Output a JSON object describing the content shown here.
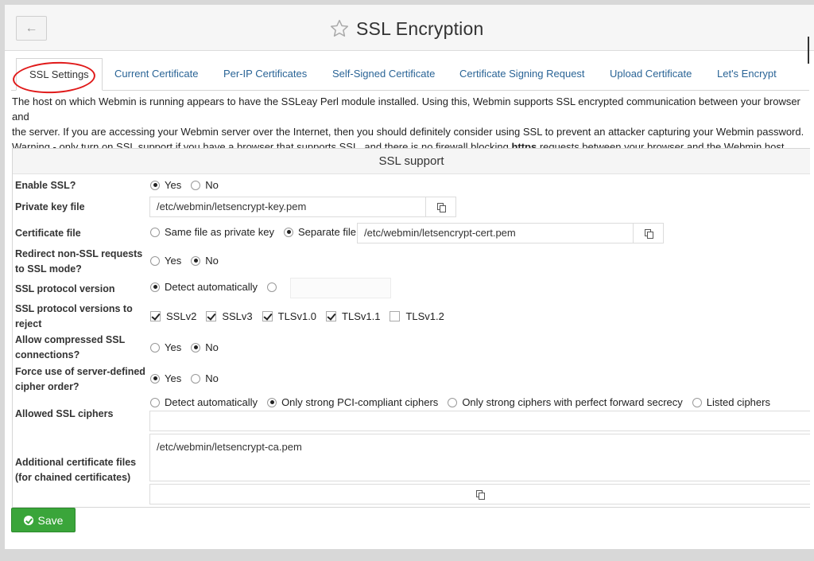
{
  "header": {
    "title": "SSL Encryption",
    "back_icon": "arrow-left-icon",
    "star_icon": "star-outline-icon"
  },
  "tabs": [
    {
      "label": "SSL Settings",
      "active": true
    },
    {
      "label": "Current Certificate"
    },
    {
      "label": "Per-IP Certificates"
    },
    {
      "label": "Self-Signed Certificate"
    },
    {
      "label": "Certificate Signing Request"
    },
    {
      "label": "Upload Certificate"
    },
    {
      "label": "Let's Encrypt"
    }
  ],
  "intro": {
    "line1": "The host on which Webmin is running appears to have the SSLeay Perl module installed. Using this, Webmin supports SSL encrypted communication between your browser and",
    "line2": "the server. If you are accessing your Webmin server over the Internet, then you should definitely consider using SSL to prevent an attacker capturing your Webmin password.",
    "line3_a": "Warning - only turn on SSL support if you have a browser that supports SSL, and there is no firewall blocking ",
    "line3_b": "https",
    "line3_c": " requests between your browser and the Webmin host."
  },
  "section": {
    "title": "SSL support",
    "enable_ssl": {
      "label": "Enable SSL?",
      "yes": "Yes",
      "no": "No",
      "value": "Yes"
    },
    "private_key": {
      "label": "Private key file",
      "value": "/etc/webmin/letsencrypt-key.pem"
    },
    "cert_file": {
      "label": "Certificate file",
      "opt_same": "Same file as private key",
      "opt_separate": "Separate file",
      "value": "/etc/webmin/letsencrypt-cert.pem",
      "selected": "Separate file"
    },
    "redirect": {
      "label_1": "Redirect non-SSL requests",
      "label_2": "to SSL mode?",
      "yes": "Yes",
      "no": "No",
      "value": "No"
    },
    "protocol_version": {
      "label": "SSL protocol version",
      "opt_auto": "Detect automatically",
      "value": ""
    },
    "reject_versions": {
      "label_1": "SSL protocol versions to",
      "label_2": "reject",
      "options": [
        {
          "label": "SSLv2",
          "checked": true
        },
        {
          "label": "SSLv3",
          "checked": true
        },
        {
          "label": "TLSv1.0",
          "checked": true
        },
        {
          "label": "TLSv1.1",
          "checked": true
        },
        {
          "label": "TLSv1.2",
          "checked": false
        }
      ]
    },
    "compressed": {
      "label_1": "Allow compressed SSL",
      "label_2": "connections?",
      "yes": "Yes",
      "no": "No",
      "value": "No"
    },
    "cipher_order": {
      "label_1": "Force use of server-defined",
      "label_2": "cipher order?",
      "yes": "Yes",
      "no": "No",
      "value": "Yes"
    },
    "ciphers": {
      "label": "Allowed SSL ciphers",
      "opt_auto": "Detect automatically",
      "opt_pci": "Only strong PCI-compliant ciphers",
      "opt_pfs": "Only strong ciphers with perfect forward secrecy",
      "opt_listed": "Listed ciphers",
      "selected": "Only strong PCI-compliant ciphers",
      "value": ""
    },
    "extra_certs": {
      "label_1": "Additional certificate files",
      "label_2": "(for chained certificates)",
      "value": "/etc/webmin/letsencrypt-ca.pem"
    }
  },
  "save": {
    "label": "Save",
    "icon": "check-circle-icon"
  },
  "colors": {
    "link": "#2a6496",
    "save": "#3aa53a",
    "annotation": "#e01a1a"
  }
}
